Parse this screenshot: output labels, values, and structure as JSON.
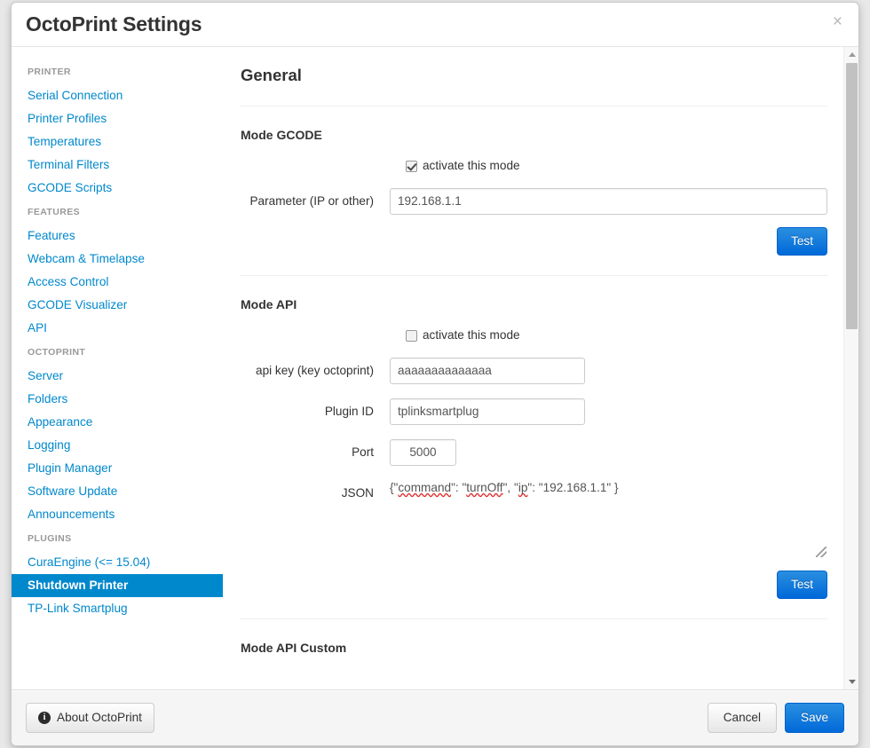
{
  "window": {
    "title": "OctoPrint Settings",
    "close_label": "×"
  },
  "sidebar": {
    "groups": [
      {
        "header": "PRINTER",
        "items": [
          {
            "label": "Serial Connection",
            "active": false
          },
          {
            "label": "Printer Profiles",
            "active": false
          },
          {
            "label": "Temperatures",
            "active": false
          },
          {
            "label": "Terminal Filters",
            "active": false
          },
          {
            "label": "GCODE Scripts",
            "active": false
          }
        ]
      },
      {
        "header": "FEATURES",
        "items": [
          {
            "label": "Features",
            "active": false
          },
          {
            "label": "Webcam & Timelapse",
            "active": false
          },
          {
            "label": "Access Control",
            "active": false
          },
          {
            "label": "GCODE Visualizer",
            "active": false
          },
          {
            "label": "API",
            "active": false
          }
        ]
      },
      {
        "header": "OCTOPRINT",
        "items": [
          {
            "label": "Server",
            "active": false
          },
          {
            "label": "Folders",
            "active": false
          },
          {
            "label": "Appearance",
            "active": false
          },
          {
            "label": "Logging",
            "active": false
          },
          {
            "label": "Plugin Manager",
            "active": false
          },
          {
            "label": "Software Update",
            "active": false
          },
          {
            "label": "Announcements",
            "active": false
          }
        ]
      },
      {
        "header": "PLUGINS",
        "items": [
          {
            "label": "CuraEngine (<= 15.04)",
            "active": false
          },
          {
            "label": "Shutdown Printer",
            "active": true
          },
          {
            "label": "TP-Link Smartplug",
            "active": false
          }
        ]
      }
    ]
  },
  "main": {
    "page_title": "General",
    "sections": {
      "gcode": {
        "title": "Mode GCODE",
        "activate_label": "activate this mode",
        "activate_checked": true,
        "parameter_label": "Parameter (IP or other)",
        "parameter_value": "192.168.1.1",
        "test_label": "Test"
      },
      "api": {
        "title": "Mode API",
        "activate_label": "activate this mode",
        "activate_checked": false,
        "apikey_label": "api key (key octoprint)",
        "apikey_value": "aaaaaaaaaaaaaa",
        "pluginid_label": "Plugin ID",
        "pluginid_value": "tplinksmartplug",
        "port_label": "Port",
        "port_value": "5000",
        "json_label": "JSON",
        "json_value": "{\"command\": \"turnOff\", \"ip\": \"192.168.1.1\" }",
        "json_tokens": {
          "open": "{\"",
          "command_word": "command",
          "mid1": "\": \"",
          "turnoff_word": "turnOff",
          "mid2": "\", \"",
          "ip_word": "ip",
          "mid3": "\": \"192.168.1.1\" }"
        },
        "test_label": "Test"
      },
      "api_custom": {
        "title": "Mode API Custom"
      }
    }
  },
  "footer": {
    "about_label": "About OctoPrint",
    "about_icon": "info-icon",
    "cancel_label": "Cancel",
    "save_label": "Save"
  },
  "scrollbar": {
    "up_icon": "caret-up-icon",
    "down_icon": "caret-down-icon"
  },
  "colors": {
    "accent": "#0088cc",
    "primary_button": "#0069d9",
    "link": "#0088cc",
    "muted": "#999999"
  }
}
